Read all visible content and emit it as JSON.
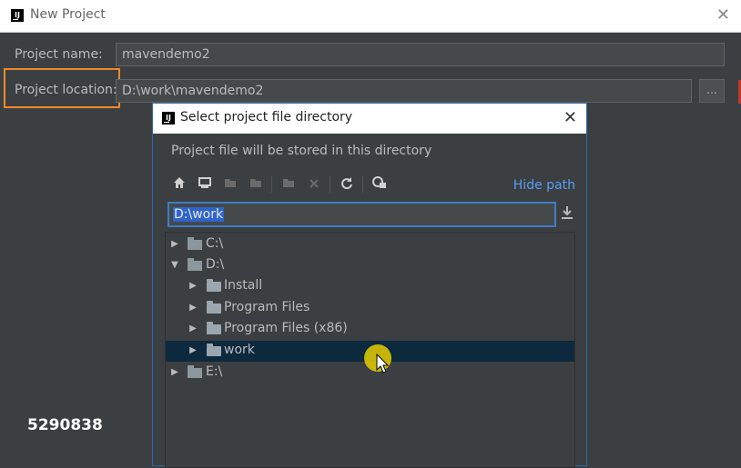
{
  "window": {
    "title": "New Project",
    "close_glyph": "✕"
  },
  "form": {
    "project_name_label": "Project name:",
    "project_name_value": "mavendemo2",
    "project_location_label": "Project location:",
    "project_location_value": "D:\\work\\mavendemo2",
    "browse_label": "..."
  },
  "dialog": {
    "title": "Select project file directory",
    "close_glyph": "✕",
    "hint": "Project file will be stored in this directory",
    "hide_path_label": "Hide path",
    "path_value": "D:\\work",
    "toolbar_icons": [
      "home-icon",
      "desktop-icon",
      "project-folder-icon",
      "module-folder-icon",
      "new-folder-icon",
      "delete-icon",
      "refresh-icon",
      "show-hidden-icon"
    ],
    "tree": [
      {
        "label": "C:\\",
        "expanded": false,
        "kind": "drive"
      },
      {
        "label": "D:\\",
        "expanded": true,
        "kind": "drive"
      },
      {
        "label": "Install",
        "expanded": false,
        "kind": "folder"
      },
      {
        "label": "Program Files",
        "expanded": false,
        "kind": "folder"
      },
      {
        "label": "Program Files (x86)",
        "expanded": false,
        "kind": "folder"
      },
      {
        "label": "work",
        "expanded": false,
        "kind": "folder",
        "selected": true
      },
      {
        "label": "E:\\",
        "expanded": false,
        "kind": "drive"
      }
    ]
  },
  "overlay": {
    "watermark": "5290838"
  },
  "colors": {
    "accent": "#589df6",
    "selection": "#0d293e",
    "highlight_box": "#f0882b",
    "background": "#3c3f41"
  }
}
